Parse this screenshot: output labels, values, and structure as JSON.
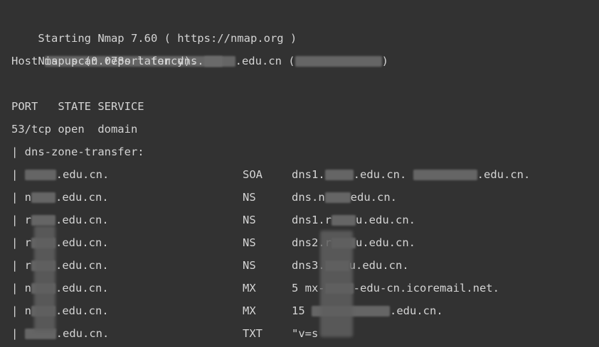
{
  "lines": {
    "start": "Starting Nmap 7.60 ( https://nmap.org )",
    "report_prefix": "Nmap scan report for dns.",
    "report_domain": ".edu.cn (",
    "report_close": ")",
    "host": "Host is up (0.078s latency).",
    "blank": "",
    "header": "PORT   STATE SERVICE",
    "port": "53/tcp open  domain",
    "script": "| dns-zone-transfer:"
  },
  "records": [
    {
      "pipe": "| ",
      "prefix": "",
      "name": ".edu.cn.",
      "type": "SOA",
      "value_prefix": "dns1.",
      "value_suffix": ".edu.cn.",
      "value_extra": ".edu.cn."
    },
    {
      "pipe": "| ",
      "prefix": "n",
      "name": ".edu.cn.",
      "type": "NS",
      "value_prefix": "dns.n",
      "value_suffix": "edu.cn.",
      "value_extra": ""
    },
    {
      "pipe": "| ",
      "prefix": "r",
      "name": ".edu.cn.",
      "type": "NS",
      "value_prefix": "dns1.r",
      "value_suffix": "u.edu.cn.",
      "value_extra": ""
    },
    {
      "pipe": "| ",
      "prefix": "r",
      "name": ".edu.cn.",
      "type": "NS",
      "value_prefix": "dns2.r",
      "value_suffix": "u.edu.cn.",
      "value_extra": ""
    },
    {
      "pipe": "| ",
      "prefix": "r",
      "name": ".edu.cn.",
      "type": "NS",
      "value_prefix": "dns3.",
      "value_suffix": "u.edu.cn.",
      "value_extra": ""
    },
    {
      "pipe": "| ",
      "prefix": "n",
      "name": ".edu.cn.",
      "type": "MX",
      "value_prefix": "5 mx-",
      "value_suffix": "-edu-cn.icoremail.net.",
      "value_extra": ""
    },
    {
      "pipe": "| ",
      "prefix": "n",
      "name": ".edu.cn.",
      "type": "MX",
      "value_prefix": "15 ",
      "value_suffix": ".edu.cn.",
      "value_extra": ""
    },
    {
      "pipe": "| ",
      "prefix": "",
      "name": ".edu.cn.",
      "type": "TXT",
      "value_prefix": "\"v=s",
      "value_suffix": "",
      "value_extra": ""
    }
  ],
  "colors": {
    "background": "#323232",
    "text": "#d4d4d4",
    "redaction": "#6b6b6b"
  }
}
